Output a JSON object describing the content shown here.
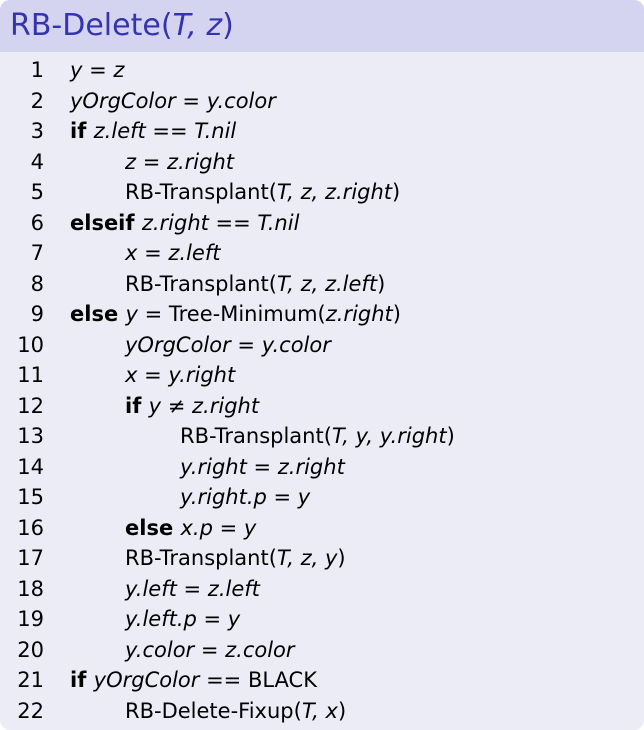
{
  "title_prefix": "RB-Delete(",
  "title_args": "T, z",
  "title_suffix": ")",
  "lines": [
    {
      "n": "1",
      "depth": 0,
      "parts": [
        [
          "i",
          "y = z"
        ]
      ]
    },
    {
      "n": "2",
      "depth": 0,
      "parts": [
        [
          "i",
          "yOrgColor = y.color"
        ]
      ]
    },
    {
      "n": "3",
      "depth": 0,
      "parts": [
        [
          "b",
          "if "
        ],
        [
          "i",
          "z.left == T.nil"
        ]
      ]
    },
    {
      "n": "4",
      "depth": 1,
      "parts": [
        [
          "i",
          "z = z.right"
        ]
      ]
    },
    {
      "n": "5",
      "depth": 1,
      "parts": [
        [
          "t",
          "RB-Transplant("
        ],
        [
          "i",
          "T, z, z.right"
        ],
        [
          "t",
          ")"
        ]
      ]
    },
    {
      "n": "6",
      "depth": 0,
      "parts": [
        [
          "b",
          "elseif "
        ],
        [
          "i",
          "z.right == T.nil"
        ]
      ]
    },
    {
      "n": "7",
      "depth": 1,
      "parts": [
        [
          "i",
          "x = z.left"
        ]
      ]
    },
    {
      "n": "8",
      "depth": 1,
      "parts": [
        [
          "t",
          "RB-Transplant("
        ],
        [
          "i",
          "T, z, z.left"
        ],
        [
          "t",
          ")"
        ]
      ]
    },
    {
      "n": "9",
      "depth": 0,
      "parts": [
        [
          "b",
          "else "
        ],
        [
          "i",
          "y"
        ],
        [
          "t",
          " = Tree-Minimum("
        ],
        [
          "i",
          "z.right"
        ],
        [
          "t",
          ")"
        ]
      ]
    },
    {
      "n": "10",
      "depth": 1,
      "parts": [
        [
          "i",
          "yOrgColor = y.color"
        ]
      ]
    },
    {
      "n": "11",
      "depth": 1,
      "parts": [
        [
          "i",
          "x = y.right"
        ]
      ]
    },
    {
      "n": "12",
      "depth": 1,
      "parts": [
        [
          "b",
          "if "
        ],
        [
          "i",
          "y ≠ z.right"
        ]
      ]
    },
    {
      "n": "13",
      "depth": 2,
      "parts": [
        [
          "t",
          "RB-Transplant("
        ],
        [
          "i",
          "T, y, y.right"
        ],
        [
          "t",
          ")"
        ]
      ]
    },
    {
      "n": "14",
      "depth": 2,
      "parts": [
        [
          "i",
          "y.right = z.right"
        ]
      ]
    },
    {
      "n": "15",
      "depth": 2,
      "parts": [
        [
          "i",
          "y.right.p = y"
        ]
      ]
    },
    {
      "n": "16",
      "depth": 1,
      "parts": [
        [
          "b",
          "else "
        ],
        [
          "i",
          "x.p = y"
        ]
      ]
    },
    {
      "n": "17",
      "depth": 1,
      "parts": [
        [
          "t",
          "RB-Transplant("
        ],
        [
          "i",
          "T, z, y"
        ],
        [
          "t",
          ")"
        ]
      ]
    },
    {
      "n": "18",
      "depth": 1,
      "parts": [
        [
          "i",
          "y.left = z.left"
        ]
      ]
    },
    {
      "n": "19",
      "depth": 1,
      "parts": [
        [
          "i",
          "y.left.p = y"
        ]
      ]
    },
    {
      "n": "20",
      "depth": 1,
      "parts": [
        [
          "i",
          "y.color = z.color"
        ]
      ]
    },
    {
      "n": "21",
      "depth": 0,
      "parts": [
        [
          "b",
          "if "
        ],
        [
          "i",
          "yOrgColor"
        ],
        [
          "t",
          " == BLACK"
        ]
      ]
    },
    {
      "n": "22",
      "depth": 1,
      "parts": [
        [
          "t",
          "RB-Delete-Fixup("
        ],
        [
          "i",
          "T, x"
        ],
        [
          "t",
          ")"
        ]
      ]
    }
  ]
}
